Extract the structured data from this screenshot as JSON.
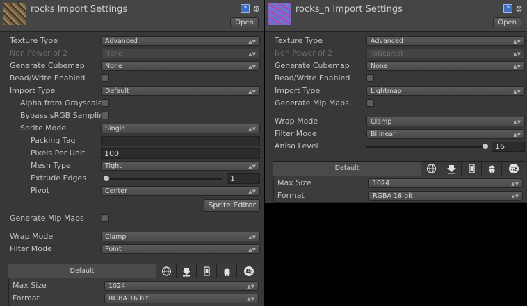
{
  "left": {
    "title": "rocks Import Settings",
    "open_label": "Open",
    "rows": {
      "texture_type": {
        "label": "Texture Type",
        "value": "Advanced"
      },
      "non_power_of_2": {
        "label": "Non Power of 2",
        "value": "None"
      },
      "generate_cubemap": {
        "label": "Generate Cubemap",
        "value": "None"
      },
      "read_write": {
        "label": "Read/Write Enabled"
      },
      "import_type": {
        "label": "Import Type",
        "value": "Default"
      },
      "alpha_grayscale": {
        "label": "Alpha from Grayscale"
      },
      "bypass_srgb": {
        "label": "Bypass sRGB Sampling"
      },
      "sprite_mode": {
        "label": "Sprite Mode",
        "value": "Single"
      },
      "packing_tag": {
        "label": "Packing Tag",
        "value": ""
      },
      "pixels_per_unit": {
        "label": "Pixels Per Unit",
        "value": "100"
      },
      "mesh_type": {
        "label": "Mesh Type",
        "value": "Tight"
      },
      "extrude_edges": {
        "label": "Extrude Edges",
        "value": "1"
      },
      "pivot": {
        "label": "Pivot",
        "value": "Center"
      },
      "generate_mip_maps": {
        "label": "Generate Mip Maps"
      },
      "wrap_mode": {
        "label": "Wrap Mode",
        "value": "Clamp"
      },
      "filter_mode": {
        "label": "Filter Mode",
        "value": "Point"
      }
    },
    "sprite_editor_label": "Sprite Editor",
    "platform_default_label": "Default",
    "max_size": {
      "label": "Max Size",
      "value": "1024"
    },
    "format": {
      "label": "Format",
      "value": "RGBA 16 bit"
    }
  },
  "right": {
    "title": "rocks_n Import Settings",
    "open_label": "Open",
    "rows": {
      "texture_type": {
        "label": "Texture Type",
        "value": "Advanced"
      },
      "non_power_of_2": {
        "label": "Non Power of 2",
        "value": "ToNearest"
      },
      "generate_cubemap": {
        "label": "Generate Cubemap",
        "value": "None"
      },
      "read_write": {
        "label": "Read/Write Enabled"
      },
      "import_type": {
        "label": "Import Type",
        "value": "Lightmap"
      },
      "generate_mip_maps": {
        "label": "Generate Mip Maps"
      },
      "wrap_mode": {
        "label": "Wrap Mode",
        "value": "Clamp"
      },
      "filter_mode": {
        "label": "Filter Mode",
        "value": "Bilinear"
      },
      "aniso_level": {
        "label": "Aniso Level",
        "value": "16"
      }
    },
    "platform_default_label": "Default",
    "max_size": {
      "label": "Max Size",
      "value": "1024"
    },
    "format": {
      "label": "Format",
      "value": "RGBA 16 bit"
    }
  },
  "icons": {
    "help": "help-book-icon",
    "gear": "gear-icon",
    "arrow": "dropdown-arrows-icon"
  },
  "colors": {
    "panel_bg": "#383838",
    "header_bg": "#454545",
    "text": "#c3c3c3",
    "dim_text": "#6b6b6b"
  }
}
